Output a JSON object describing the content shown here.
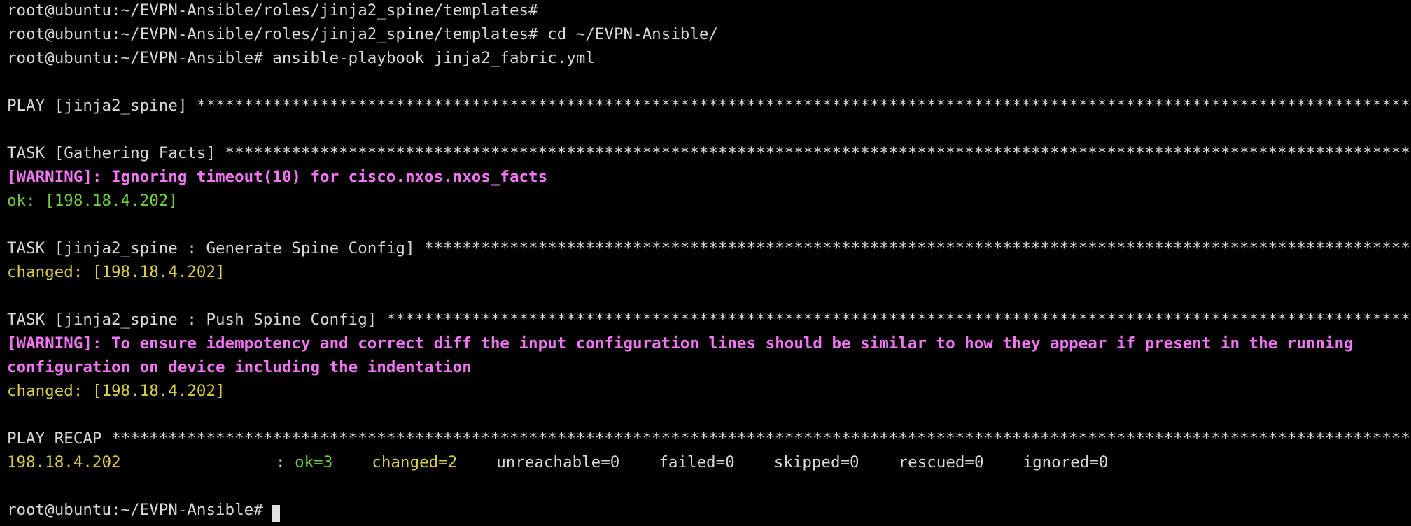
{
  "terminal": {
    "prompt_templates": "root@ubuntu:~/EVPN-Ansible/roles/jinja2_spine/templates#",
    "cmd_cd_prompt": "root@ubuntu:~/EVPN-Ansible/roles/jinja2_spine/templates#",
    "cmd_cd": " cd ~/EVPN-Ansible/",
    "cmd_play_prompt": "root@ubuntu:~/EVPN-Ansible#",
    "cmd_play": " ansible-playbook jinja2_fabric.yml",
    "play_header": "PLAY [jinja2_spine] ****************************************************************************************************************************************************************************************************************************",
    "task_facts_header": "TASK [Gathering Facts] *************************************************************************************************************************************************************************************************************************",
    "warning_timeout": "[WARNING]: Ignoring timeout(10) for cisco.nxos.nxos_facts",
    "ok_host": "ok: [198.18.4.202]",
    "task_generate_header": "TASK [jinja2_spine : Generate Spine Config] ****************************************************************************************************************************************************************************************",
    "changed_generate": "changed: [198.18.4.202]",
    "task_push_header": "TASK [jinja2_spine : Push Spine Config] ********************************************************************************************************************************************************************************************",
    "warning_idempotency_1": "[WARNING]: To ensure idempotency and correct diff the input configuration lines should be similar to how they appear if present in the running",
    "warning_idempotency_2": "configuration on device including the indentation",
    "changed_push": "changed: [198.18.4.202]",
    "recap_header": "PLAY RECAP *************************************************************************************************************************************************************************************************************************************",
    "recap": {
      "host": "198.18.4.202",
      "sep": ": ",
      "ok": "ok=3",
      "changed": "changed=2",
      "unreachable": "unreachable=0",
      "failed": "failed=0",
      "skipped": "skipped=0",
      "rescued": "rescued=0",
      "ignored": "ignored=0"
    },
    "final_prompt": "root@ubuntu:~/EVPN-Ansible#"
  },
  "colors": {
    "background": "#000000",
    "text": "#d8d8d8",
    "ok_green": "#6fcf3f",
    "changed_yellow": "#d9cf46",
    "warning_magenta": "#f176f2"
  }
}
